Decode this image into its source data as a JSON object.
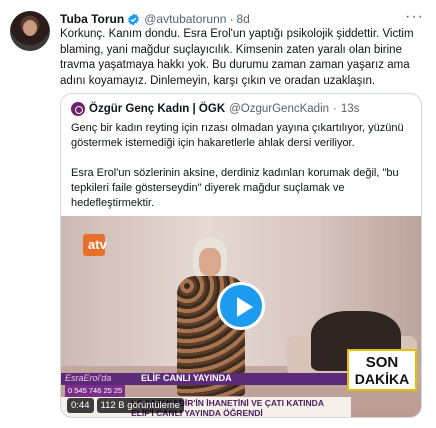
{
  "tweet": {
    "name": "Tuba Torun",
    "handle": "@avtubatorunn",
    "time": "8d",
    "text": "Korkunç. Kanım dondu. Esra Erol'un yaptığı psikolojik şiddettir. Victim blaming, yani mağdur suçlayıcılık. Kimsenin zaten yaralı olan birine travma yaşatmaya hakkı yok. Bu durumu zaman zaman yaşarız ama adını koyamayız. Dinlemeyin, karşı çıkın ve oradan uzaklaşın.",
    "more_icon": "ellipsis-icon",
    "verified_color": "#1d9bf0"
  },
  "quote": {
    "name": "Özgür Genç Kadın | ÖGK",
    "handle": "@OzgurGencKadin",
    "time": "13s",
    "paragraph1": "Genç bir kadın reyting için rızası olmadan yayına çıkartılıyor, yüzünü göstermek istemediği için hakaretlerle ahlak dersi veriliyor.",
    "paragraph2": "Esra Erol'un sözlerinin aksine, derdiniz kadınları korumak değil, \"bu tepkileri faile gösterseydin\" diyerek mağdur suçlamak ve hedefleştirmektir."
  },
  "video": {
    "logo_text": "atv",
    "channel_text": "EsraErol'da",
    "label": "ELİF CANLI YAYINDA",
    "phone": "0 545 746 25 25",
    "headline_line1": "KOCASI KADİR'İN İHANETİNİ VE ÇATI KATINDA",
    "headline_line2": "ELİF'İ CANLI YAYINDA ÖĞRENDİ",
    "breaking_line1": "SON",
    "breaking_line2": "DAKİKA",
    "duration": "0:44",
    "views": "112 B görüntüleme",
    "play_color": "#1d9bf0"
  }
}
